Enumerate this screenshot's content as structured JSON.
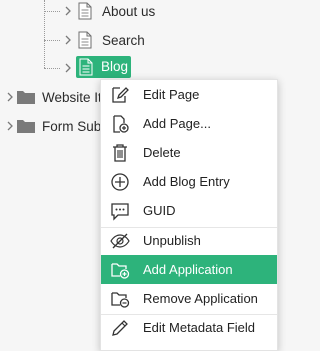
{
  "tree": {
    "items": [
      {
        "label": "About us",
        "icon": "document-icon"
      },
      {
        "label": "Search",
        "icon": "document-icon"
      },
      {
        "label": "Blog",
        "icon": "document-icon",
        "selected": true
      },
      {
        "label": "Website Ite",
        "icon": "folder-icon"
      },
      {
        "label": "Form Subn",
        "icon": "folder-icon"
      }
    ],
    "selected_color": "#2db37b"
  },
  "context_menu": {
    "items": [
      {
        "label": "Edit Page",
        "icon": "edit-page-icon"
      },
      {
        "label": "Add Page...",
        "icon": "add-page-icon"
      },
      {
        "label": "Delete",
        "icon": "trash-icon"
      },
      {
        "label": "Add Blog Entry",
        "icon": "plus-circle-icon"
      },
      {
        "label": "GUID",
        "icon": "guid-icon"
      },
      {
        "label": "Unpublish",
        "icon": "eye-slash-icon"
      },
      {
        "label": "Add Application",
        "icon": "add-application-icon",
        "highlighted": true
      },
      {
        "label": "Remove Application",
        "icon": "remove-application-icon"
      },
      {
        "label": "Edit Metadata Field",
        "icon": "pencil-icon"
      }
    ],
    "highlight_color": "#2db37b"
  }
}
